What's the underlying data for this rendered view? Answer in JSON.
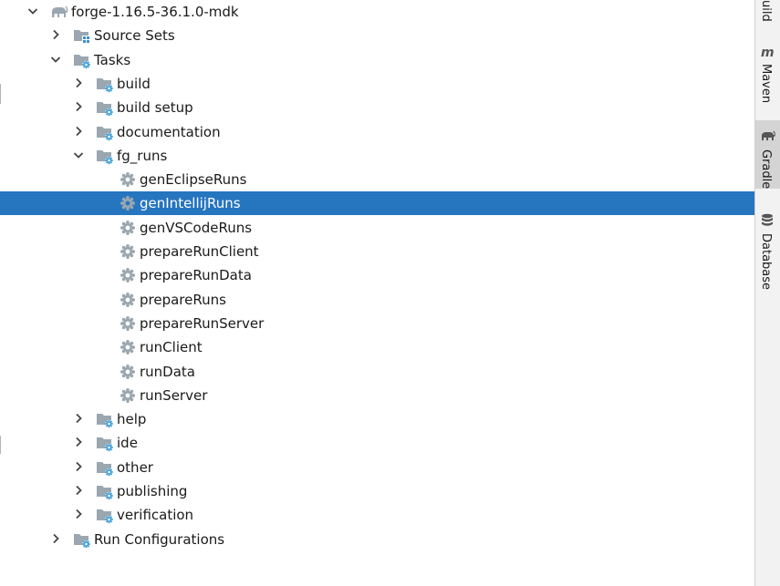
{
  "tree": {
    "rows": [
      {
        "label": "forge-1.16.5-36.1.0-mdk",
        "level": 0,
        "expander": "expanded",
        "icon": "gradle-elephant-icon"
      },
      {
        "label": "Source Sets",
        "level": 1,
        "expander": "collapsed",
        "icon": "source-sets-folder-icon"
      },
      {
        "label": "Tasks",
        "level": 1,
        "expander": "expanded",
        "icon": "task-folder-icon"
      },
      {
        "label": "build",
        "level": 2,
        "expander": "collapsed",
        "icon": "task-folder-icon"
      },
      {
        "label": "build setup",
        "level": 2,
        "expander": "collapsed",
        "icon": "task-folder-icon"
      },
      {
        "label": "documentation",
        "level": 2,
        "expander": "collapsed",
        "icon": "task-folder-icon"
      },
      {
        "label": "fg_runs",
        "level": 2,
        "expander": "expanded",
        "icon": "task-folder-icon"
      },
      {
        "label": "genEclipseRuns",
        "level": 3,
        "expander": "none",
        "icon": "gear-icon"
      },
      {
        "label": "genIntellijRuns",
        "level": 3,
        "expander": "none",
        "icon": "gear-icon",
        "selected": true
      },
      {
        "label": "genVSCodeRuns",
        "level": 3,
        "expander": "none",
        "icon": "gear-icon"
      },
      {
        "label": "prepareRunClient",
        "level": 3,
        "expander": "none",
        "icon": "gear-icon"
      },
      {
        "label": "prepareRunData",
        "level": 3,
        "expander": "none",
        "icon": "gear-icon"
      },
      {
        "label": "prepareRuns",
        "level": 3,
        "expander": "none",
        "icon": "gear-icon"
      },
      {
        "label": "prepareRunServer",
        "level": 3,
        "expander": "none",
        "icon": "gear-icon"
      },
      {
        "label": "runClient",
        "level": 3,
        "expander": "none",
        "icon": "gear-icon"
      },
      {
        "label": "runData",
        "level": 3,
        "expander": "none",
        "icon": "gear-icon"
      },
      {
        "label": "runServer",
        "level": 3,
        "expander": "none",
        "icon": "gear-icon"
      },
      {
        "label": "help",
        "level": 2,
        "expander": "collapsed",
        "icon": "task-folder-icon"
      },
      {
        "label": "ide",
        "level": 2,
        "expander": "collapsed",
        "icon": "task-folder-icon"
      },
      {
        "label": "other",
        "level": 2,
        "expander": "collapsed",
        "icon": "task-folder-icon"
      },
      {
        "label": "publishing",
        "level": 2,
        "expander": "collapsed",
        "icon": "task-folder-icon"
      },
      {
        "label": "verification",
        "level": 2,
        "expander": "collapsed",
        "icon": "task-folder-icon"
      },
      {
        "label": "Run Configurations",
        "level": 1,
        "expander": "collapsed",
        "icon": "run-config-folder-icon"
      }
    ]
  },
  "right_toolbar": {
    "tabs": [
      {
        "label": "uild",
        "icon": "",
        "active": false
      },
      {
        "label": "Maven",
        "icon": "maven-icon",
        "active": false
      },
      {
        "label": "Gradle",
        "icon": "gradle-elephant-icon",
        "active": true
      },
      {
        "label": "Database",
        "icon": "database-icon",
        "active": false
      }
    ]
  },
  "colors": {
    "selection": "#2675bf",
    "folder": "#9aa7b0",
    "gear": "#9aa7b0",
    "badge_gear": "#40a0d8",
    "badge_blue": "#3d8fd1",
    "text": "#1a1a1a"
  }
}
